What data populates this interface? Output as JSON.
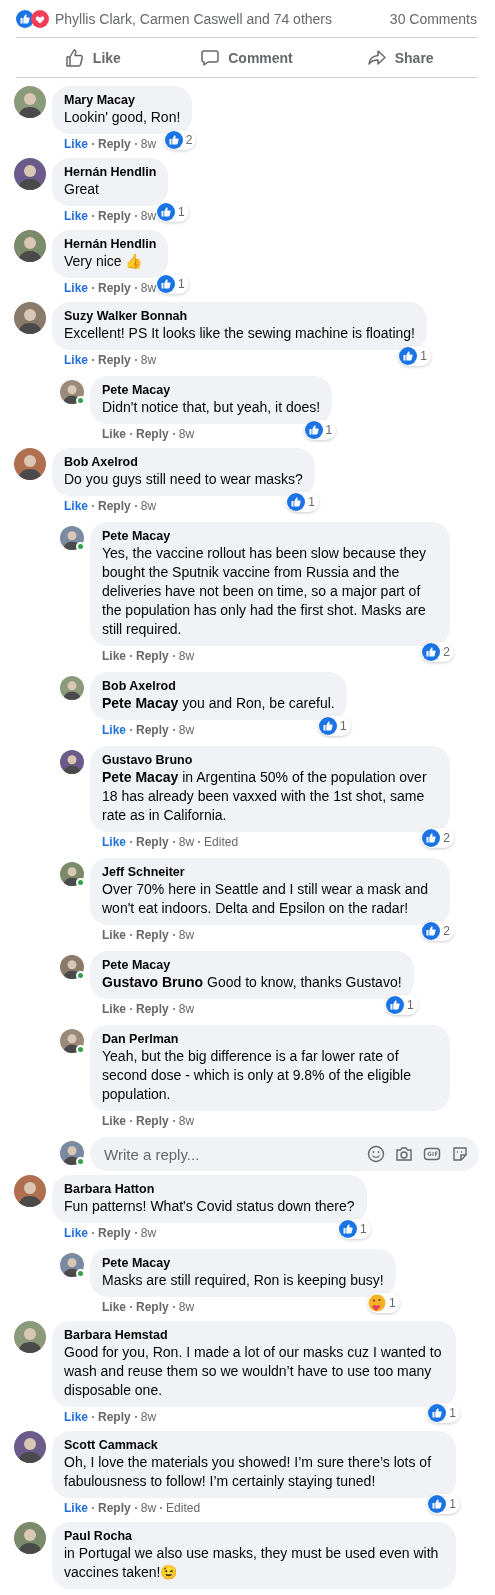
{
  "summary": {
    "names": "Phyllis Clark, Carmen Caswell and 74 others",
    "comments_count": "30 Comments"
  },
  "actions": [
    {
      "kind": "like",
      "label": "Like"
    },
    {
      "kind": "comment",
      "label": "Comment"
    },
    {
      "kind": "share",
      "label": "Share"
    }
  ],
  "comments": [
    {
      "author": "Mary Macay",
      "text": "Lookin' good, Ron!",
      "like": "Like",
      "liked": true,
      "reply": "Reply",
      "time": "8w",
      "reaction": {
        "kind": "like",
        "count": "2"
      },
      "online": false
    },
    {
      "author": "Hernán Hendlin",
      "text": "Great",
      "like": "Like",
      "liked": true,
      "reply": "Reply",
      "time": "8w",
      "reaction": {
        "kind": "like",
        "count": "1"
      },
      "online": false
    },
    {
      "author": "Hernán Hendlin",
      "text": "Very nice 👍",
      "like": "Like",
      "liked": true,
      "reply": "Reply",
      "time": "8w",
      "reaction": {
        "kind": "like",
        "count": "1"
      },
      "online": false
    },
    {
      "author": "Suzy Walker Bonnah",
      "text": "Excellent! PS It looks like the sewing machine is floating!",
      "like": "Like",
      "liked": true,
      "reply": "Reply",
      "time": "8w",
      "reaction": {
        "kind": "like",
        "count": "1"
      },
      "online": false,
      "replies": [
        {
          "author": "Pete Macay",
          "text": "Didn't notice that, but yeah, it does!",
          "like": "Like",
          "liked": false,
          "reply": "Reply",
          "time": "8w",
          "reaction": {
            "kind": "like",
            "count": "1"
          },
          "online": true
        }
      ]
    },
    {
      "author": "Bob Axelrod",
      "text": "Do you guys still need to wear masks?",
      "like": "Like",
      "liked": true,
      "reply": "Reply",
      "time": "8w",
      "reaction": {
        "kind": "like",
        "count": "1"
      },
      "online": false,
      "replies": [
        {
          "author": "Pete Macay",
          "text": "Yes, the vaccine rollout has been slow because they bought the Sputnik vaccine from Russia and the deliveries have not been on time, so a major part of the population has only had the first shot. Masks are still required.",
          "like": "Like",
          "liked": false,
          "reply": "Reply",
          "time": "8w",
          "reaction": {
            "kind": "like",
            "count": "2"
          },
          "online": true
        },
        {
          "author": "Bob Axelrod",
          "text": "**Pete Macay** you and Ron, be careful.",
          "like": "Like",
          "liked": true,
          "reply": "Reply",
          "time": "8w",
          "reaction": {
            "kind": "like",
            "count": "1"
          },
          "online": false
        },
        {
          "author": "Gustavo Bruno",
          "text": "**Pete Macay** in Argentina 50% of the population over 18 has already been vaxxed with the 1st shot, same rate as in California.",
          "like": "Like",
          "liked": true,
          "reply": "Reply",
          "time": "8w",
          "edited": "Edited",
          "reaction": {
            "kind": "like",
            "count": "2"
          },
          "online": false
        },
        {
          "author": "Jeff Schneiter",
          "text": "Over 70% here in Seattle and I still wear a mask and won't eat indoors. Delta and Epsilon on the radar!",
          "like": "Like",
          "liked": false,
          "reply": "Reply",
          "time": "8w",
          "reaction": {
            "kind": "like",
            "count": "2"
          },
          "online": true
        },
        {
          "author": "Pete Macay",
          "text": "**Gustavo Bruno** Good to know, thanks Gustavo!",
          "like": "Like",
          "liked": false,
          "reply": "Reply",
          "time": "8w",
          "reaction": {
            "kind": "like",
            "count": "1"
          },
          "online": true
        },
        {
          "author": "Dan Perlman",
          "text": "Yeah, but the big difference is a far lower rate of second dose - which is only at 9.8% of the eligible population.",
          "like": "Like",
          "liked": false,
          "reply": "Reply",
          "time": "8w",
          "online": true
        }
      ],
      "reply_box": {
        "placeholder": "Write a reply...",
        "online": true
      }
    },
    {
      "author": "Barbara Hatton",
      "text": "Fun patterns! What's Covid status down there?",
      "like": "Like",
      "liked": true,
      "reply": "Reply",
      "time": "8w",
      "reaction": {
        "kind": "like",
        "count": "1"
      },
      "online": false,
      "replies": [
        {
          "author": "Pete Macay",
          "text": "Masks are still required, Ron is keeping busy!",
          "like": "Like",
          "liked": false,
          "reply": "Reply",
          "time": "8w",
          "reaction": {
            "kind": "care",
            "count": "1"
          },
          "online": true
        }
      ]
    },
    {
      "author": "Barbara Hemstad",
      "text": "Good for you, Ron. I made a lot of our masks cuz I wanted to wash and reuse them so we wouldn’t have to use too many disposable one.",
      "like": "Like",
      "liked": true,
      "reply": "Reply",
      "time": "8w",
      "reaction": {
        "kind": "like",
        "count": "1"
      },
      "online": false
    },
    {
      "author": "Scott Cammack",
      "text": "Oh, I love the materials you showed! I’m sure there’s lots of fabulousness to follow! I’m certainly staying tuned!",
      "like": "Like",
      "liked": true,
      "reply": "Reply",
      "time": "8w",
      "edited": "Edited",
      "reaction": {
        "kind": "like",
        "count": "1"
      },
      "online": false
    },
    {
      "author": "Paul Rocha",
      "text": "in Portugal we also use masks, they must be used even with vaccines taken!😉",
      "online": false
    }
  ]
}
